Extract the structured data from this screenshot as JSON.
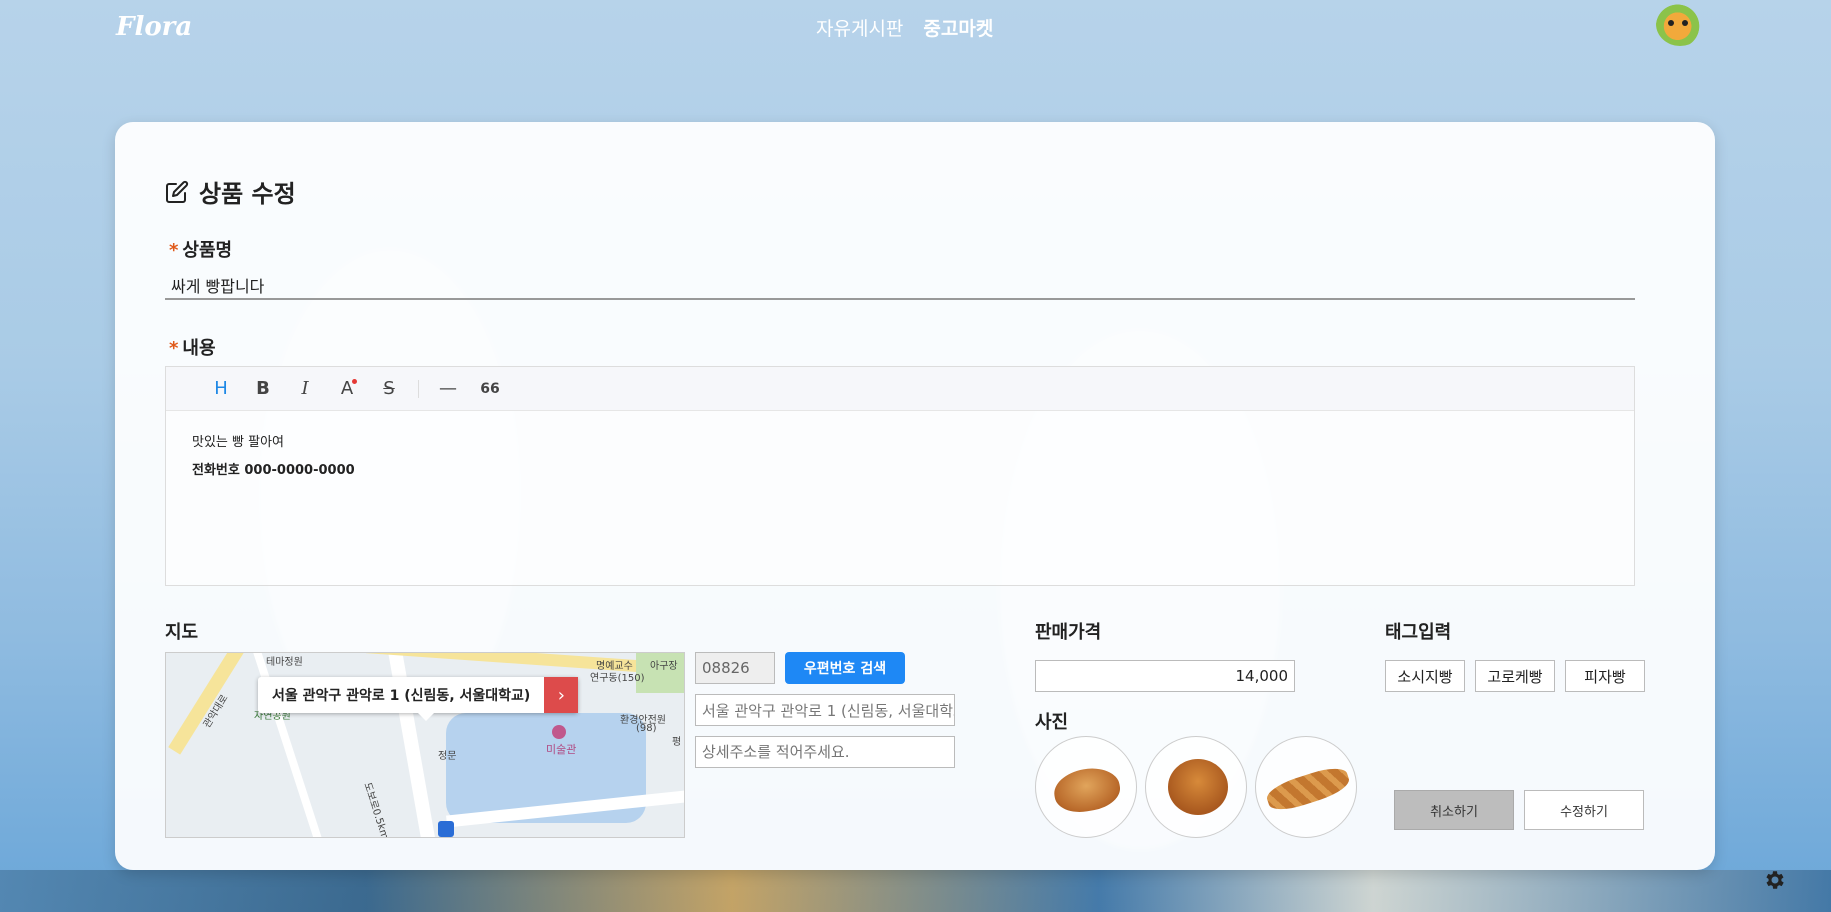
{
  "app": {
    "logo": "Flora"
  },
  "nav": {
    "items": [
      {
        "label": "자유게시판"
      },
      {
        "label": "중고마켓"
      }
    ]
  },
  "form": {
    "title": "상품 수정",
    "required_mark": "*",
    "name_label": "상품명",
    "name_value": "싸게 빵팝니다",
    "content_label": "내용",
    "content_lines": [
      "맛있는 빵 팔아여",
      "전화번호 000-0000-0000"
    ],
    "toolbar": {
      "heading": "H",
      "bold": "B",
      "italic": "I",
      "color": "A",
      "strike": "S",
      "hr": "—",
      "quote": "66"
    },
    "map_label": "지도",
    "map": {
      "popup_address": "서울 관악구 관악로 1 (신림동, 서울대학교)",
      "places": [
        "테마정원",
        "관악대로",
        "명예교수",
        "연구동(150)",
        "아구장",
        "환경안전원",
        "(98)",
        "미술관",
        "정문",
        "자연공원",
        "평",
        "도보로0.5km"
      ]
    },
    "postcode": {
      "value": "08826",
      "button": "우편번호 검색"
    },
    "address": {
      "value": "서울 관악구 관악로 1 (신림동, 서울대학교)",
      "detail_placeholder": "상세주소를 적어주세요."
    },
    "price_label": "판매가격",
    "price_value": "14,000",
    "photo_label": "사진",
    "tags_label": "태그입력",
    "tags": [
      "소시지빵",
      "고로케빵",
      "피자빵"
    ],
    "cancel_label": "취소하기",
    "submit_label": "수정하기"
  },
  "colors": {
    "accent": "#1e88f5",
    "required": "#e05a1a",
    "map_button": "#dd4b4b"
  },
  "icons": {
    "title": "edit-icon",
    "settings": "gear-icon",
    "map_go": "chevron-right-icon"
  }
}
